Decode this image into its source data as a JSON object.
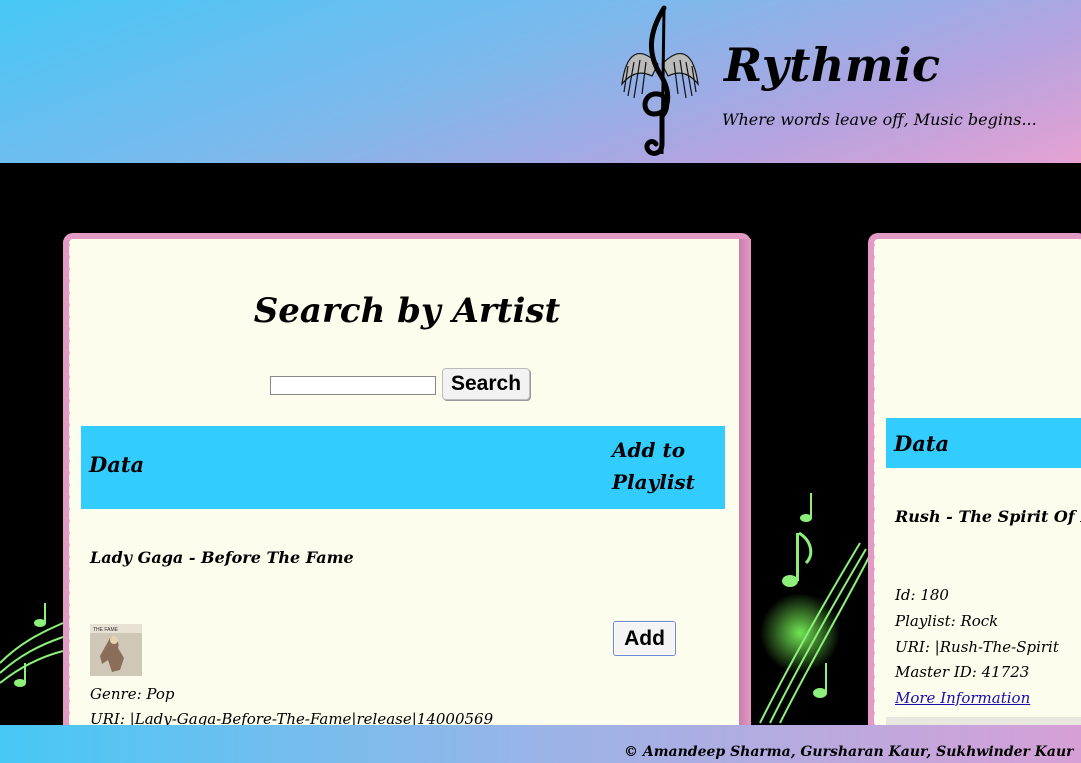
{
  "header": {
    "brand": "Rythmic",
    "tagline": "Where words leave off, Music begins..."
  },
  "search_panel": {
    "title": "Search by Artist",
    "search_input": {
      "value": "",
      "placeholder": ""
    },
    "search_button": "Search",
    "table": {
      "col_data": "Data",
      "col_add_line1": "Add to",
      "col_add_line2": "Playlist"
    },
    "result": {
      "title": "Lady Gaga - Before The Fame",
      "add_button": "Add",
      "genre": "Genre: Pop",
      "uri": "URI: |Lady-Gaga-Before-The-Fame|release|14000569",
      "album_art_label": "THE FAME"
    }
  },
  "playlist_panel": {
    "col_data": "Data",
    "item": {
      "title": "Rush - The Spirit Of R",
      "id": "Id: 180",
      "playlist": "Playlist: Rock",
      "uri": "URI: |Rush-The-Spirit",
      "master_id": "Master ID: 41723",
      "link": "More Information"
    }
  },
  "footer": {
    "copyright": "© Amandeep Sharma, Gursharan Kaur, Sukhwinder Kaur"
  },
  "colors": {
    "table_header": "#33ccff",
    "panel_border": "#e39ac5",
    "panel_bg": "#fdfdee"
  }
}
